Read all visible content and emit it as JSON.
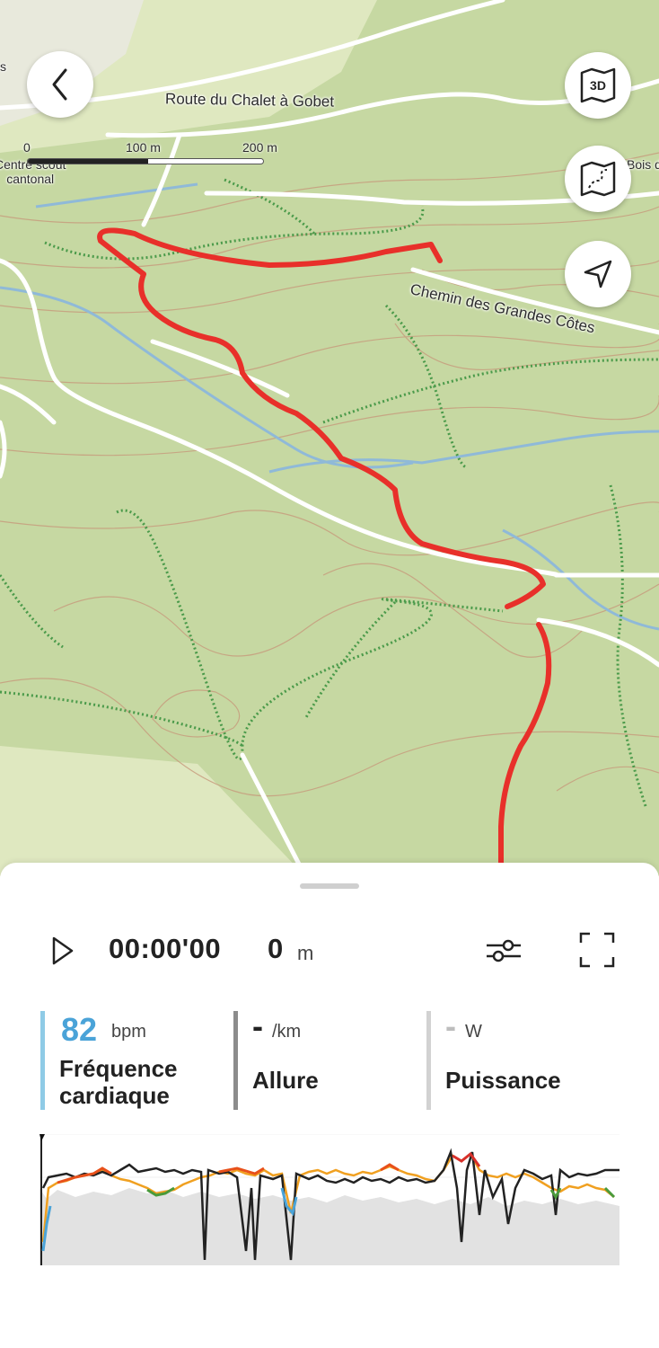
{
  "map": {
    "road_label": "Route du Chalet à Gobet",
    "trail_label": "Chemin des Grandes Côtes",
    "poi_label": "Centre scout cantonal",
    "poi_label_line1": "Centre scout",
    "poi_label_line2": "cantonal",
    "edge_label_right": "Bois d",
    "edge_label_left": "s",
    "scale": {
      "zero": "0",
      "mid": "100 m",
      "end": "200 m"
    },
    "buttons": {
      "back": "back-icon",
      "mode_3d": "3D",
      "map_style": "map-route-icon",
      "locate": "navigation-arrow-icon"
    },
    "route_color": "#e8302a",
    "terrain_color": "#c6d8a2"
  },
  "playback": {
    "time": "00:00'00",
    "distance_value": "0",
    "distance_unit": "m"
  },
  "metrics": {
    "heart_rate": {
      "value": "82",
      "unit": "bpm",
      "label_line1": "Fréquence",
      "label_line2": "cardiaque",
      "color": "#4aa3d8"
    },
    "pace": {
      "value": "-",
      "unit": "/km",
      "label": "Allure"
    },
    "power": {
      "value": "-",
      "unit": "W",
      "label": "Puissance"
    }
  }
}
